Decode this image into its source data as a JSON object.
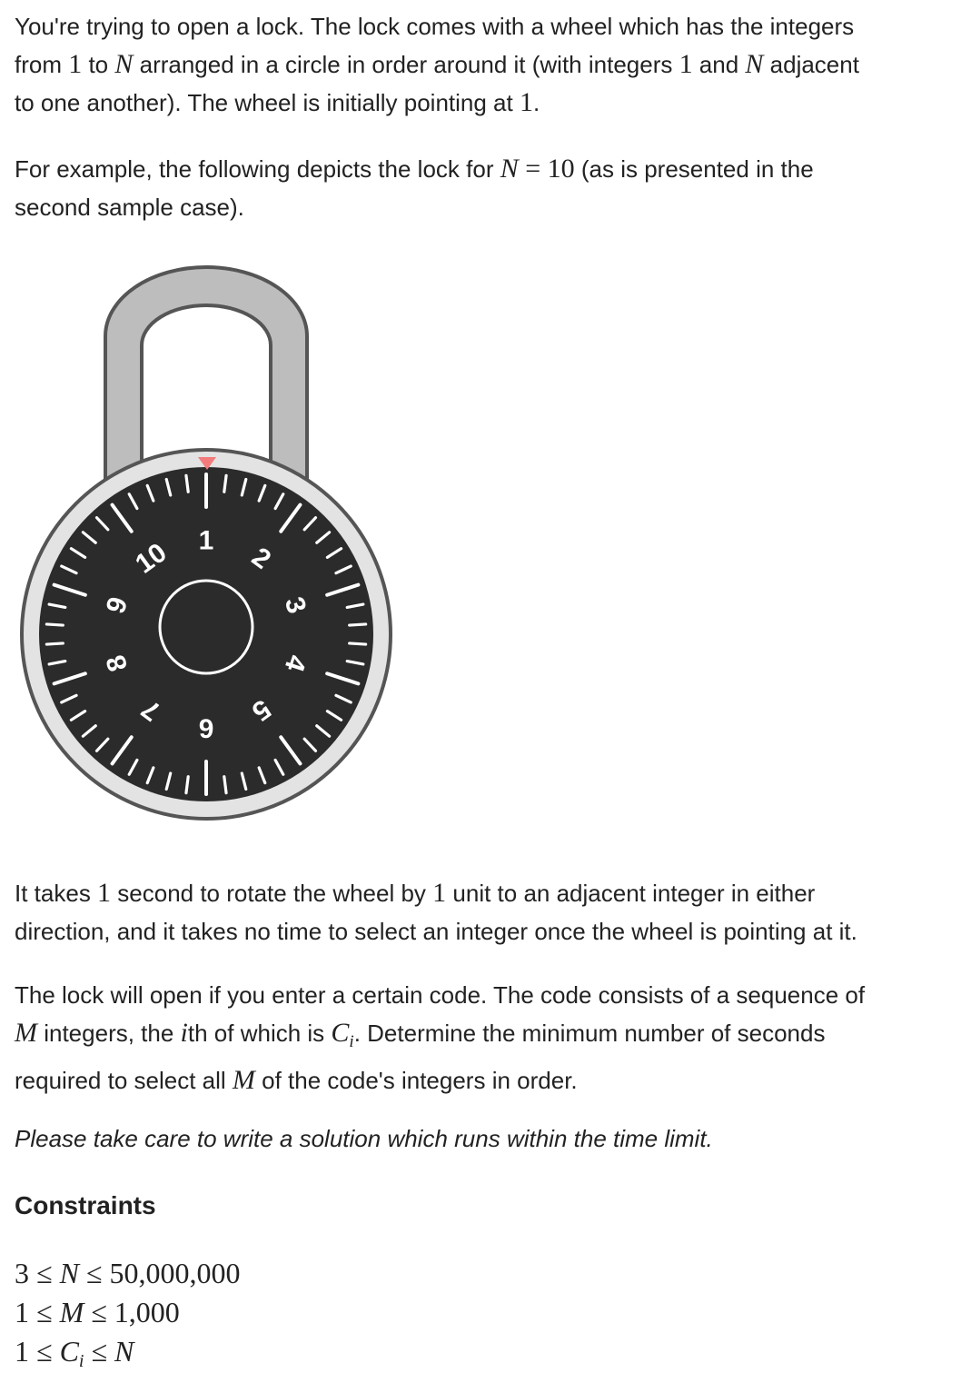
{
  "p1": {
    "t1": "You're trying to open a lock. The lock comes with a wheel which has the integers",
    "t2": "from ",
    "m1": "1",
    "t3": " to ",
    "m2": "N",
    "t4": " arranged in a circle in order around it (with integers ",
    "m3": "1",
    "t5": " and ",
    "m4": "N",
    "t6": " adjacent",
    "t7": "to one another). The wheel is initially pointing at ",
    "m5": "1",
    "t8": "."
  },
  "p2": {
    "t1": "For example, the following depicts the lock for ",
    "m1": "N",
    "m2": " = ",
    "m3": "10",
    "t2": " (as is presented in the",
    "t3": "second sample case)."
  },
  "lock": {
    "dial_numbers": [
      "1",
      "2",
      "3",
      "4",
      "5",
      "6",
      "7",
      "8",
      "9",
      "10"
    ],
    "pointer_color": "#f47b7b",
    "dial_color": "#2b2b2b",
    "ring_color": "#e0e0e0",
    "shackle_color": "#9a9a9a"
  },
  "p3": {
    "t1": "It takes ",
    "m1": "1",
    "t2": " second to rotate the wheel by ",
    "m2": "1",
    "t3": " unit to an adjacent integer in either",
    "t4": "direction, and it takes no time to select an integer once the wheel is pointing at it."
  },
  "p4": {
    "t1": "The lock will open if you enter a certain code. The code consists of a sequence of",
    "m1": "M",
    "t2": " integers, the ",
    "m2": "i",
    "t3": "th of which is ",
    "m3": "C",
    "m3sub": "i",
    "t4": ". Determine the minimum number of seconds",
    "t5": "required to select all ",
    "m4": "M",
    "t6": " of the code's integers in order."
  },
  "note": "Please take care to write a solution which runs within the time limit.",
  "constraints": {
    "heading": "Constraints",
    "c1": {
      "a": "3 ≤ ",
      "v": "N",
      "b": " ≤ 50,000,000"
    },
    "c2": {
      "a": "1 ≤ ",
      "v": "M",
      "b": " ≤ 1,000"
    },
    "c3": {
      "a": "1 ≤ ",
      "v": "C",
      "sub": "i",
      "b": " ≤ ",
      "v2": "N"
    }
  }
}
